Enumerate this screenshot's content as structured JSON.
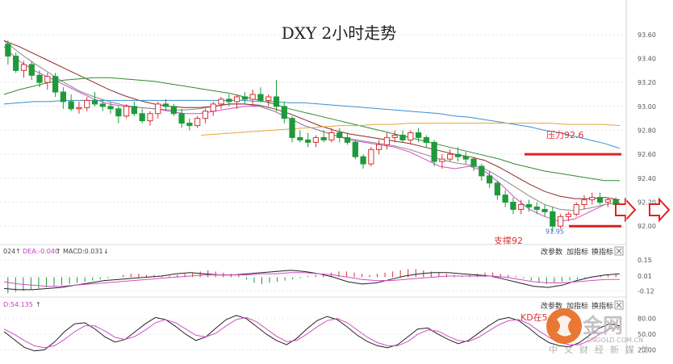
{
  "chart_data": [
    {
      "type": "line",
      "title": "DXY 2小时走势",
      "ylim": [
        91.88,
        93.7
      ],
      "yticks": [
        "93.60",
        "93.40",
        "93.20",
        "93.00",
        "92.80",
        "92.60",
        "92.40",
        "92.20",
        "92.00"
      ],
      "candles": [
        [
          93.52,
          93.55,
          93.35,
          93.42
        ],
        [
          93.42,
          93.45,
          93.28,
          93.3
        ],
        [
          93.3,
          93.38,
          93.24,
          93.35
        ],
        [
          93.35,
          93.38,
          93.22,
          93.26
        ],
        [
          93.26,
          93.3,
          93.16,
          93.2
        ],
        [
          93.2,
          93.28,
          93.14,
          93.25
        ],
        [
          93.25,
          93.28,
          93.08,
          93.12
        ],
        [
          93.12,
          93.16,
          92.98,
          93.04
        ],
        [
          93.04,
          93.1,
          92.96,
          92.98
        ],
        [
          92.98,
          93.04,
          92.94,
          92.99
        ],
        [
          92.99,
          93.08,
          92.96,
          93.05
        ],
        [
          93.05,
          93.12,
          93.0,
          93.02
        ],
        [
          93.02,
          93.06,
          92.96,
          93.0
        ],
        [
          93.0,
          93.04,
          92.94,
          92.98
        ],
        [
          92.98,
          93.0,
          92.86,
          92.92
        ],
        [
          92.92,
          93.02,
          92.9,
          93.0
        ],
        [
          93.0,
          93.04,
          92.92,
          92.94
        ],
        [
          92.94,
          92.98,
          92.86,
          92.88
        ],
        [
          92.88,
          92.96,
          92.84,
          92.94
        ],
        [
          92.94,
          93.04,
          92.9,
          93.02
        ],
        [
          93.02,
          93.06,
          92.96,
          93.0
        ],
        [
          93.0,
          93.02,
          92.92,
          92.94
        ],
        [
          92.94,
          92.98,
          92.82,
          92.86
        ],
        [
          92.86,
          92.9,
          92.8,
          92.84
        ],
        [
          92.84,
          92.92,
          92.82,
          92.9
        ],
        [
          92.9,
          92.98,
          92.86,
          92.96
        ],
        [
          92.96,
          93.04,
          92.92,
          93.02
        ],
        [
          93.02,
          93.08,
          92.98,
          93.06
        ],
        [
          93.06,
          93.1,
          93.0,
          93.04
        ],
        [
          93.04,
          93.1,
          92.98,
          93.08
        ],
        [
          93.08,
          93.12,
          93.02,
          93.06
        ],
        [
          93.06,
          93.14,
          93.02,
          93.1
        ],
        [
          93.1,
          93.16,
          93.04,
          93.05
        ],
        [
          93.05,
          93.1,
          93.0,
          93.08
        ],
        [
          93.08,
          93.22,
          92.96,
          93.0
        ],
        [
          93.0,
          93.04,
          92.86,
          92.9
        ],
        [
          92.9,
          92.92,
          92.7,
          92.74
        ],
        [
          92.74,
          92.8,
          92.7,
          92.72
        ],
        [
          92.72,
          92.78,
          92.66,
          92.7
        ],
        [
          92.7,
          92.76,
          92.66,
          92.74
        ],
        [
          92.74,
          92.8,
          92.7,
          92.72
        ],
        [
          92.72,
          92.82,
          92.7,
          92.78
        ],
        [
          92.78,
          92.82,
          92.7,
          92.74
        ],
        [
          92.74,
          92.78,
          92.68,
          92.7
        ],
        [
          92.7,
          92.72,
          92.56,
          92.58
        ],
        [
          92.58,
          92.6,
          92.48,
          92.52
        ],
        [
          92.52,
          92.66,
          92.5,
          92.64
        ],
        [
          92.64,
          92.72,
          92.6,
          92.68
        ],
        [
          92.68,
          92.78,
          92.64,
          92.74
        ],
        [
          92.74,
          92.8,
          92.7,
          92.76
        ],
        [
          92.76,
          92.8,
          92.7,
          92.72
        ],
        [
          92.72,
          92.8,
          92.68,
          92.78
        ],
        [
          92.78,
          92.82,
          92.7,
          92.74
        ],
        [
          92.74,
          92.76,
          92.66,
          92.7
        ],
        [
          92.7,
          92.72,
          92.5,
          92.54
        ],
        [
          92.54,
          92.6,
          92.48,
          92.56
        ],
        [
          92.56,
          92.64,
          92.54,
          92.6
        ],
        [
          92.6,
          92.66,
          92.54,
          92.58
        ],
        [
          92.58,
          92.62,
          92.52,
          92.56
        ],
        [
          92.56,
          92.58,
          92.46,
          92.5
        ],
        [
          92.5,
          92.52,
          92.38,
          92.42
        ],
        [
          92.42,
          92.46,
          92.32,
          92.36
        ],
        [
          92.36,
          92.38,
          92.22,
          92.26
        ],
        [
          92.26,
          92.3,
          92.16,
          92.2
        ],
        [
          92.2,
          92.24,
          92.1,
          92.14
        ],
        [
          92.14,
          92.22,
          92.1,
          92.18
        ],
        [
          92.18,
          92.22,
          92.12,
          92.16
        ],
        [
          92.16,
          92.2,
          92.1,
          92.14
        ],
        [
          92.14,
          92.18,
          92.08,
          92.12
        ],
        [
          92.12,
          92.16,
          91.95,
          92.0
        ],
        [
          92.0,
          92.1,
          91.98,
          92.08
        ],
        [
          92.08,
          92.12,
          92.04,
          92.1
        ],
        [
          92.1,
          92.2,
          92.08,
          92.18
        ],
        [
          92.18,
          92.26,
          92.14,
          92.22
        ],
        [
          92.22,
          92.28,
          92.18,
          92.24
        ],
        [
          92.24,
          92.28,
          92.18,
          92.2
        ],
        [
          92.2,
          92.24,
          92.16,
          92.22
        ],
        [
          92.22,
          92.24,
          92.16,
          92.18
        ]
      ],
      "ma_series": [
        {
          "color": "#d04ec8",
          "values": [
            93.5,
            93.38,
            93.3,
            93.24,
            93.18,
            93.12,
            93.06,
            93.02,
            93.0,
            92.99,
            92.98,
            92.96,
            92.94,
            92.94,
            92.96,
            92.98,
            93.0,
            93.0,
            92.96,
            92.9,
            92.84,
            92.8,
            92.76,
            92.72,
            92.7,
            92.68,
            92.66,
            92.62,
            92.56,
            92.5,
            92.48,
            92.5,
            92.46,
            92.36,
            92.24,
            92.14,
            92.08,
            92.04,
            92.06,
            92.12,
            92.18,
            92.2
          ]
        },
        {
          "color": "#8a8a8a",
          "values": [
            93.55,
            93.45,
            93.36,
            93.28,
            93.2,
            93.13,
            93.08,
            93.04,
            93.01,
            92.99,
            92.98,
            92.97,
            92.97,
            92.98,
            93.0,
            93.02,
            93.02,
            93.0,
            92.96,
            92.9,
            92.84,
            92.8,
            92.76,
            92.73,
            92.71,
            92.69,
            92.67,
            92.64,
            92.6,
            92.56,
            92.53,
            92.51,
            92.48,
            92.41,
            92.33,
            92.25,
            92.18,
            92.14,
            92.13,
            92.15,
            92.18,
            92.2
          ]
        },
        {
          "color": "#8b2a2a",
          "values": [
            93.55,
            93.5,
            93.44,
            93.38,
            93.32,
            93.26,
            93.2,
            93.14,
            93.09,
            93.05,
            93.02,
            93.0,
            92.99,
            92.99,
            93.0,
            93.02,
            93.02,
            93.01,
            92.98,
            92.94,
            92.89,
            92.84,
            92.8,
            92.77,
            92.75,
            92.73,
            92.71,
            92.69,
            92.66,
            92.63,
            92.6,
            92.58,
            92.55,
            92.49,
            92.42,
            92.35,
            92.29,
            92.25,
            92.23,
            92.23,
            92.24,
            92.22
          ]
        },
        {
          "color": "#2e8b2e",
          "values": [
            93.1,
            93.14,
            93.17,
            93.2,
            93.22,
            93.23,
            93.24,
            93.24,
            93.23,
            93.22,
            93.21,
            93.19,
            93.17,
            93.15,
            93.13,
            93.11,
            93.08,
            93.05,
            93.02,
            92.98,
            92.95,
            92.92,
            92.89,
            92.86,
            92.83,
            92.8,
            92.77,
            92.74,
            92.71,
            92.68,
            92.65,
            92.62,
            92.59,
            92.56,
            92.52,
            92.49,
            92.46,
            92.44,
            92.42,
            92.4,
            92.38,
            92.38
          ]
        },
        {
          "color": "#3a8fd0",
          "values": [
            93.02,
            93.03,
            93.04,
            93.04,
            93.05,
            93.05,
            93.05,
            93.05,
            93.05,
            93.05,
            93.05,
            93.05,
            93.05,
            93.05,
            93.05,
            93.05,
            93.05,
            93.04,
            93.04,
            93.03,
            93.03,
            93.02,
            93.01,
            93.0,
            92.99,
            92.98,
            92.97,
            92.96,
            92.95,
            92.94,
            92.92,
            92.91,
            92.89,
            92.87,
            92.85,
            92.83,
            92.8,
            92.78,
            92.75,
            92.72,
            92.69,
            92.65
          ]
        },
        {
          "color": "#e8a33a",
          "start": 0.32,
          "values": [
            92.76,
            92.77,
            92.78,
            92.79,
            92.8,
            92.81,
            92.82,
            92.83,
            92.84,
            92.84,
            92.85,
            92.85,
            92.86,
            92.86,
            92.86,
            92.86,
            92.86,
            92.86,
            92.86,
            92.86,
            92.86,
            92.85,
            92.85,
            92.85,
            92.84
          ]
        }
      ],
      "resistance": {
        "label": "压力92.6",
        "value": 92.6
      },
      "support": {
        "label": "支撑92",
        "value": 92.0
      },
      "low_marker": "91.95"
    },
    {
      "type": "bar",
      "header": {
        "prefix": "024",
        "dea": "DEA:-0.040",
        "macd": "MACD:0.031"
      },
      "yticks": [
        "0.15",
        "0.01",
        "-0.12"
      ],
      "ylim": [
        -0.16,
        0.18
      ],
      "values": [
        -0.14,
        -0.13,
        -0.12,
        -0.11,
        -0.1,
        -0.09,
        -0.08,
        -0.07,
        -0.06,
        -0.05,
        -0.04,
        -0.03,
        -0.02,
        -0.01,
        0.0,
        0.02,
        0.03,
        0.03,
        0.02,
        0.02,
        0.01,
        0.01,
        0.02,
        0.03,
        0.04,
        0.05,
        0.06,
        0.05,
        0.04,
        0.03,
        0.02,
        -0.02,
        -0.05,
        -0.06,
        -0.05,
        -0.04,
        -0.03,
        -0.02,
        -0.01,
        0.01,
        0.02,
        0.03,
        0.04,
        0.05,
        0.05,
        0.04,
        0.03,
        0.02,
        0.03,
        0.04,
        0.05,
        0.06,
        0.07,
        0.07,
        0.06,
        0.05,
        0.04,
        0.03,
        0.02,
        0.01,
        0.02,
        0.03,
        0.04,
        0.04,
        0.03,
        0.02,
        0.01,
        -0.01,
        -0.03,
        -0.05,
        -0.06,
        -0.05,
        -0.04,
        -0.03,
        -0.02,
        -0.01,
        0.0,
        0.01,
        0.02,
        0.03
      ],
      "dif": [
        -0.1,
        -0.11,
        -0.11,
        -0.1,
        -0.09,
        -0.07,
        -0.05,
        -0.03,
        -0.02,
        -0.01,
        0.0,
        0.01,
        0.03,
        0.04,
        0.03,
        0.02,
        0.02,
        0.03,
        0.04,
        0.05,
        0.06,
        0.05,
        0.03,
        0.0,
        -0.04,
        -0.06,
        -0.05,
        -0.02,
        0.01,
        0.03,
        0.04,
        0.04,
        0.03,
        0.02,
        0.01,
        -0.02,
        -0.05,
        -0.08,
        -0.09,
        -0.07,
        -0.03,
        0.0,
        0.02,
        0.03
      ],
      "dea": [
        -0.04,
        -0.06,
        -0.07,
        -0.08,
        -0.08,
        -0.07,
        -0.06,
        -0.05,
        -0.04,
        -0.03,
        -0.02,
        -0.01,
        0.0,
        0.01,
        0.02,
        0.02,
        0.02,
        0.02,
        0.03,
        0.03,
        0.04,
        0.04,
        0.03,
        0.02,
        0.0,
        -0.02,
        -0.03,
        -0.03,
        -0.02,
        -0.01,
        0.0,
        0.01,
        0.01,
        0.01,
        0.01,
        0.0,
        -0.02,
        -0.04,
        -0.05,
        -0.05,
        -0.04,
        -0.03,
        -0.02,
        -0.02
      ],
      "buttons": [
        "改参数",
        "加指标",
        "换指标"
      ]
    },
    {
      "type": "line",
      "header": "D:54.135",
      "yticks": [
        "80.00",
        "50.00",
        "20.00"
      ],
      "ylim": [
        10,
        95
      ],
      "k": [
        55,
        40,
        25,
        18,
        20,
        35,
        55,
        70,
        72,
        60,
        45,
        35,
        40,
        55,
        70,
        82,
        78,
        65,
        50,
        38,
        45,
        62,
        78,
        86,
        80,
        65,
        50,
        38,
        30,
        42,
        60,
        76,
        84,
        78,
        64,
        48,
        36,
        28,
        24,
        30,
        45,
        60,
        62,
        50,
        40,
        32,
        38,
        52,
        66,
        78,
        82,
        76,
        62,
        46,
        34,
        28,
        26,
        34,
        48,
        62,
        70,
        66
      ],
      "d": [
        60,
        50,
        38,
        28,
        24,
        28,
        40,
        55,
        66,
        66,
        56,
        44,
        40,
        46,
        58,
        72,
        78,
        72,
        60,
        48,
        45,
        52,
        66,
        78,
        82,
        74,
        60,
        46,
        36,
        38,
        50,
        64,
        76,
        80,
        72,
        58,
        44,
        34,
        28,
        28,
        36,
        50,
        58,
        56,
        46,
        38,
        36,
        44,
        56,
        68,
        76,
        78,
        70,
        56,
        44,
        34,
        30,
        30,
        38,
        50,
        60,
        64
      ],
      "buttons": [
        "改参数",
        "加指标",
        "换指标"
      ],
      "annotation": "KD在5"
    }
  ],
  "watermark": {
    "main": "金网",
    "site": "CNGOLD.COM.CN",
    "slogan": "中文财经新媒体"
  }
}
